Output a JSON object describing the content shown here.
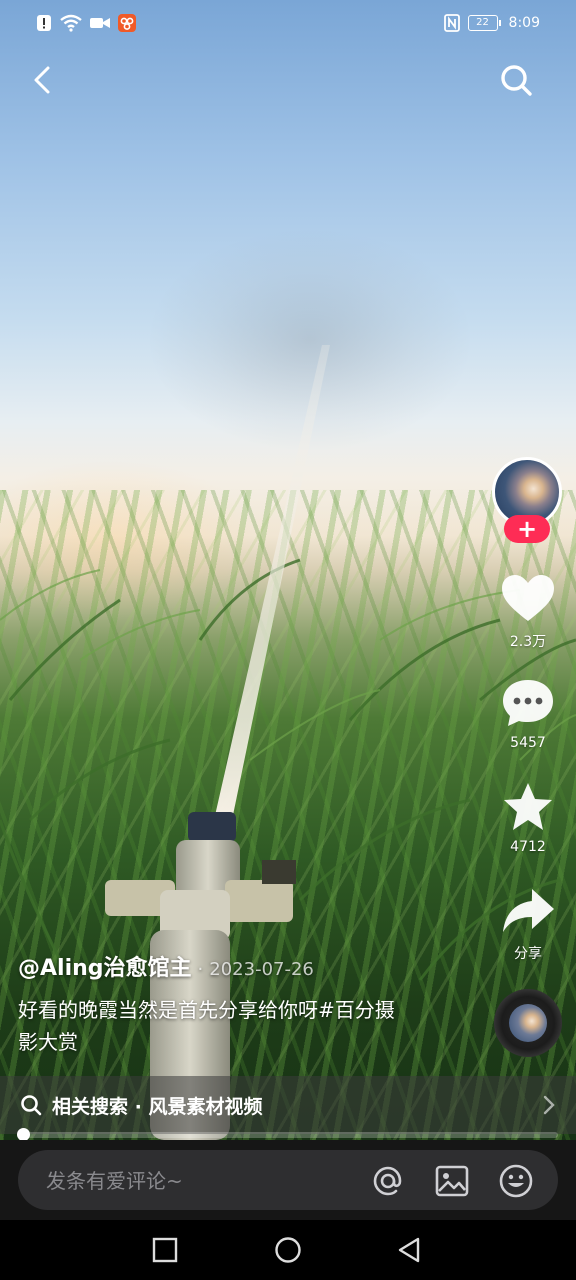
{
  "status_bar": {
    "time": "8:09",
    "battery": "22"
  },
  "author": {
    "handle": "@Aling治愈馆主",
    "separator": "·",
    "date": "2023-07-26"
  },
  "caption": {
    "text": "好看的晚霞当然是首先分享给你呀#百分摄影大赏"
  },
  "actions": {
    "likes": "2.3万",
    "comments": "5457",
    "favorites": "4712",
    "share": "分享",
    "follow": "+"
  },
  "related_search": {
    "label": "相关搜索 · 风景素材视频"
  },
  "comment": {
    "placeholder": "发条有爱评论~"
  },
  "playback": {
    "progress": 0.01
  },
  "colors": {
    "accent": "#fe2c55",
    "bar_bg": "#2e2e30"
  }
}
